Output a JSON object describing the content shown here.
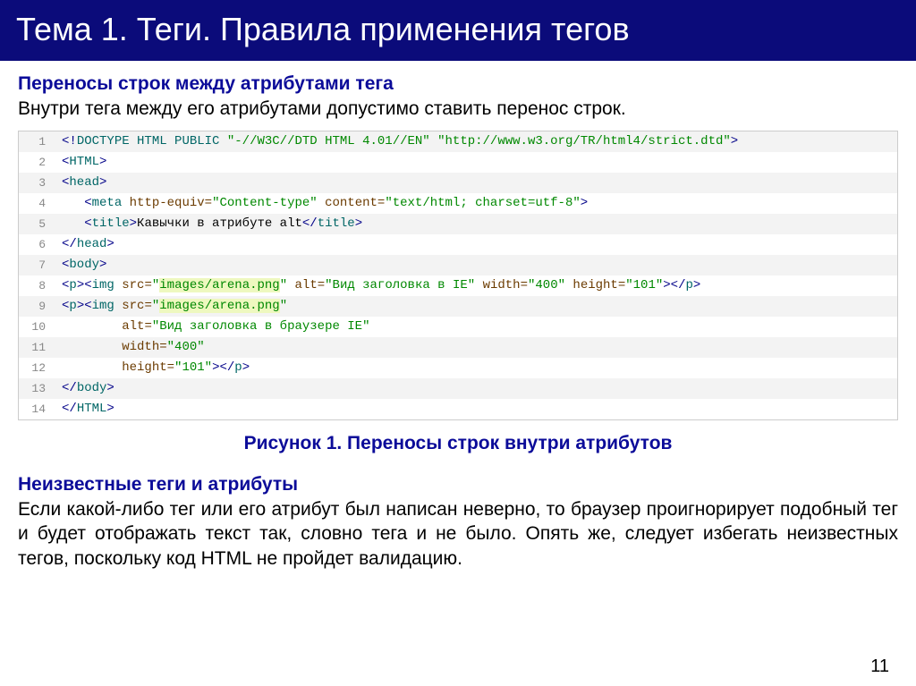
{
  "title": "Тема 1. Теги. Правила применения тегов",
  "section1": {
    "heading": "Переносы строк между атрибутами тега",
    "body": "Внутри тега между его атрибутами допустимо ставить перенос строк."
  },
  "caption": "Рисунок 1. Переносы строк внутри атрибутов",
  "section2": {
    "heading": "Неизвестные теги и атрибуты",
    "body": "Если какой-либо тег или его атрибут был написан неверно, то браузер проигнорирует подобный тег и будет отображать текст так, словно тега и не было. Опять же, следует избегать неизвестных тегов, поскольку код HTML не пройдет валидацию."
  },
  "pagenum": "11",
  "code": {
    "lines": [
      {
        "n": "1",
        "shade": true
      },
      {
        "n": "2",
        "shade": false
      },
      {
        "n": "3",
        "shade": true
      },
      {
        "n": "4",
        "shade": false
      },
      {
        "n": "5",
        "shade": true
      },
      {
        "n": "6",
        "shade": false
      },
      {
        "n": "7",
        "shade": true
      },
      {
        "n": "8",
        "shade": false
      },
      {
        "n": "9",
        "shade": true
      },
      {
        "n": "10",
        "shade": false
      },
      {
        "n": "11",
        "shade": true
      },
      {
        "n": "12",
        "shade": false
      },
      {
        "n": "13",
        "shade": true
      },
      {
        "n": "14",
        "shade": false
      }
    ],
    "l1": {
      "a": "<!",
      "b": "DOCTYPE",
      "c": " ",
      "d": "HTML",
      "e": " ",
      "f": "PUBLIC",
      "g": " ",
      "h": "\"-//W3C//DTD HTML 4.01//EN\"",
      "i": " ",
      "j": "\"http://www.w3.org/TR/html4/strict.dtd\"",
      "k": ">"
    },
    "l2": {
      "a": "<",
      "b": "HTML",
      "c": ">"
    },
    "l3": {
      "a": "<",
      "b": "head",
      "c": ">"
    },
    "l4": {
      "pad": "   ",
      "a": "<",
      "b": "meta",
      "c": " ",
      "d": "http-equiv",
      "e": "=",
      "f": "\"Content-type\"",
      "g": " ",
      "h": "content",
      "i": "=",
      "j": "\"text/html; charset=utf-8\"",
      "k": ">"
    },
    "l5": {
      "pad": "   ",
      "a": "<",
      "b": "title",
      "c": ">",
      "d": "Кавычки в атрибуте alt",
      "e": "</",
      "f": "title",
      "g": ">"
    },
    "l6": {
      "a": "</",
      "b": "head",
      "c": ">"
    },
    "l7": {
      "a": "<",
      "b": "body",
      "c": ">"
    },
    "l8": {
      "a": "<",
      "b": "p",
      "c": "><",
      "d": "img",
      "e": " ",
      "f": "src",
      "g": "=",
      "h": "\"",
      "i": "images/arena.png",
      "j": "\"",
      "k": " ",
      "l": "alt",
      "m": "=",
      "n": "\"Вид заголовка в IE\"",
      "o": " ",
      "p": "width",
      "q": "=",
      "r": "\"400\"",
      "s": " ",
      "t": "height",
      "u": "=",
      "v": "\"101\"",
      "w": "></",
      "x": "p",
      "y": ">"
    },
    "l9": {
      "a": "<",
      "b": "p",
      "c": "><",
      "d": "img",
      "e": " ",
      "f": "src",
      "g": "=",
      "h": "\"",
      "i": "images/arena.png",
      "j": "\""
    },
    "l10": {
      "pad": "        ",
      "a": "alt",
      "b": "=",
      "c": "\"Вид заголовка в браузере IE\""
    },
    "l11": {
      "pad": "        ",
      "a": "width",
      "b": "=",
      "c": "\"400\""
    },
    "l12": {
      "pad": "        ",
      "a": "height",
      "b": "=",
      "c": "\"101\"",
      "d": "></",
      "e": "p",
      "f": ">"
    },
    "l13": {
      "a": "</",
      "b": "body",
      "c": ">"
    },
    "l14": {
      "a": "</",
      "b": "HTML",
      "c": ">"
    }
  }
}
